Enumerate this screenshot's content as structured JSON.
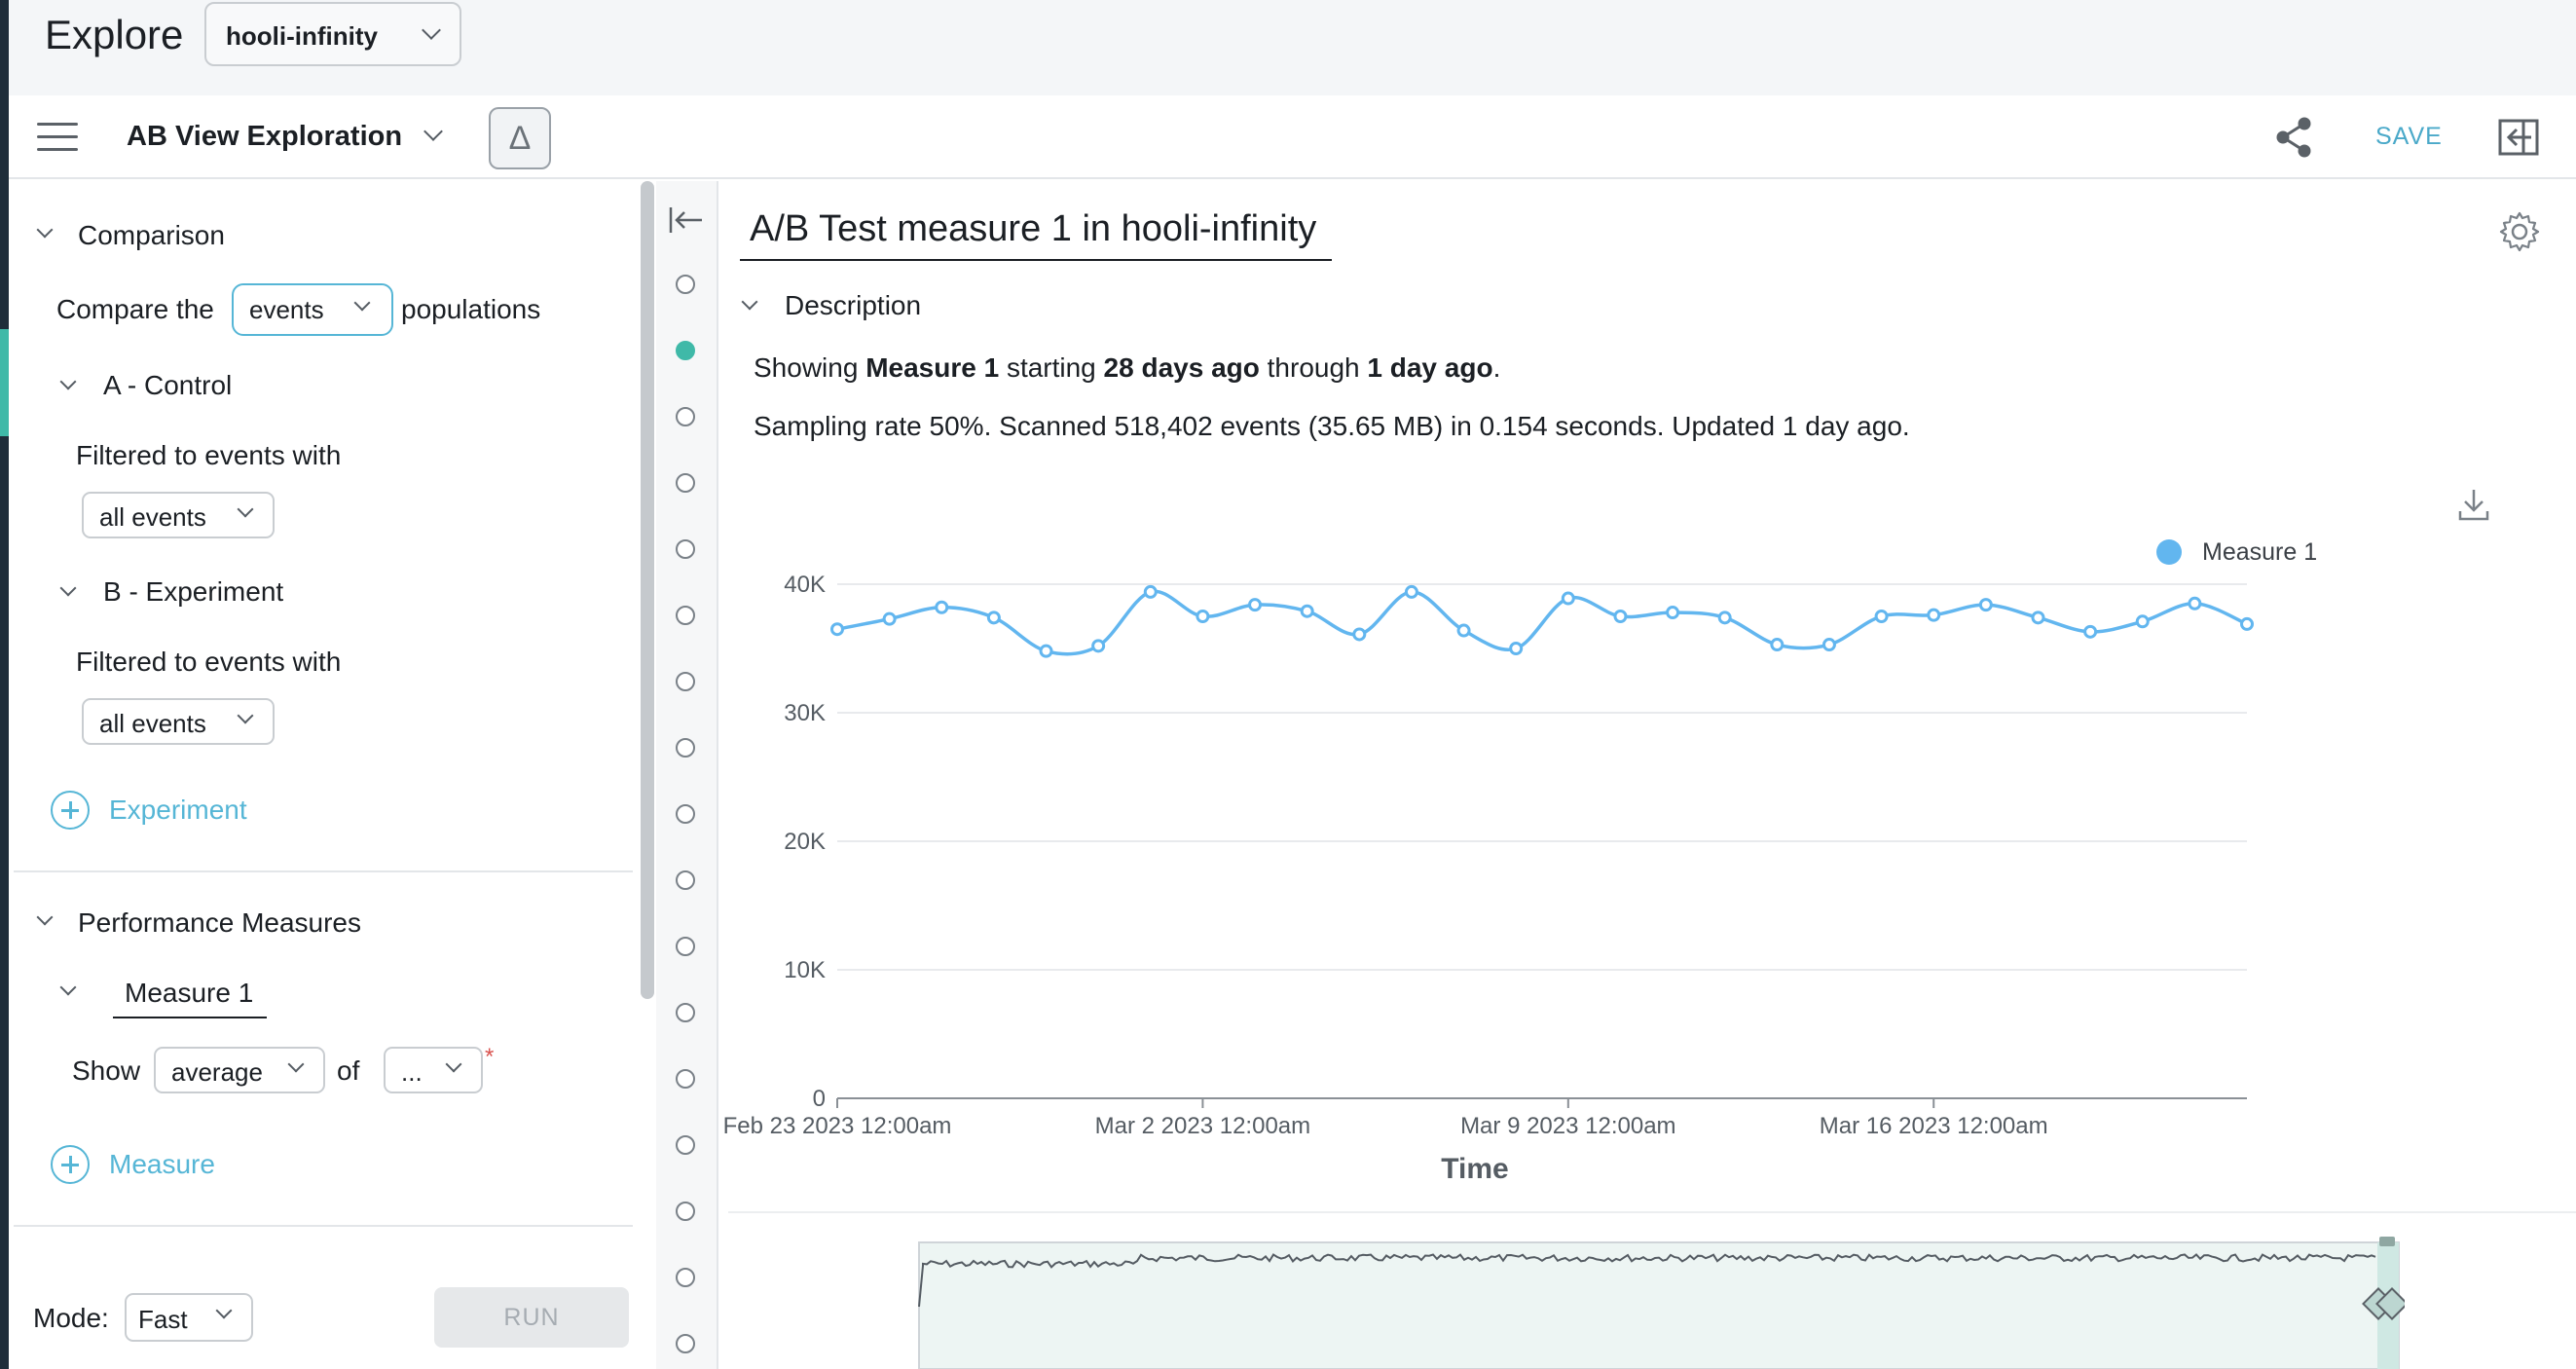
{
  "app": {
    "title": "Explore",
    "dataset": "hooli-infinity"
  },
  "toolbar": {
    "view_name": "AB View Exploration",
    "delta_symbol": "Δ",
    "save_label": "SAVE"
  },
  "comparison": {
    "heading": "Comparison",
    "compare_prefix": "Compare the",
    "compare_value": "events",
    "compare_suffix": "populations",
    "group_a": {
      "heading": "A - Control",
      "filter_label": "Filtered to events with",
      "filter_value": "all events"
    },
    "group_b": {
      "heading": "B - Experiment",
      "filter_label": "Filtered to events with",
      "filter_value": "all events"
    },
    "add_experiment": "Experiment"
  },
  "measures": {
    "heading": "Performance Measures",
    "measure_name": "Measure 1",
    "show_label": "Show",
    "agg_value": "average",
    "of_label": "of",
    "field_value": "...",
    "required_mark": "*",
    "add_measure": "Measure"
  },
  "footer": {
    "mode_label": "Mode:",
    "mode_value": "Fast",
    "run_label": "RUN"
  },
  "main": {
    "title": "A/B Test measure 1 in hooli-infinity",
    "description_heading": "Description",
    "desc": {
      "showing": "Showing",
      "measure": "Measure 1",
      "starting": "starting",
      "from": "28 days ago",
      "through": "through",
      "to": "1 day ago",
      "period": "."
    },
    "stats_line": "Sampling rate 50%. Scanned 518,402 events (35.65 MB) in 0.154 seconds. Updated 1 day ago."
  },
  "steps": {
    "count": 17,
    "active_index": 1
  },
  "colors": {
    "accent": "#56b6d6",
    "series": "#62b6ef",
    "teal": "#3fb9a8"
  },
  "chart_data": {
    "type": "line",
    "xlabel": "Time",
    "ylabel": "",
    "ylim": [
      0,
      40000
    ],
    "y_ticks": [
      "0",
      "10K",
      "20K",
      "30K",
      "40K"
    ],
    "x_ticks": [
      "Feb 23 2023 12:00am",
      "Mar 2 2023 12:00am",
      "Mar 9 2023 12:00am",
      "Mar 16 2023 12:00am"
    ],
    "legend_position": "top-right",
    "x": [
      "Feb 23",
      "Feb 24",
      "Feb 25",
      "Feb 26",
      "Feb 27",
      "Feb 28",
      "Mar 1",
      "Mar 2",
      "Mar 3",
      "Mar 4",
      "Mar 5",
      "Mar 6",
      "Mar 7",
      "Mar 8",
      "Mar 9",
      "Mar 10",
      "Mar 11",
      "Mar 12",
      "Mar 13",
      "Mar 14",
      "Mar 15",
      "Mar 16",
      "Mar 17",
      "Mar 18",
      "Mar 19",
      "Mar 20",
      "Mar 21",
      "Mar 22"
    ],
    "series": [
      {
        "name": "Measure 1",
        "values": [
          36500,
          37300,
          38200,
          37400,
          34800,
          35200,
          39400,
          37500,
          38400,
          37900,
          36100,
          39400,
          36400,
          35000,
          38900,
          37500,
          37800,
          37400,
          35300,
          35300,
          37500,
          37600,
          38400,
          37400,
          36300,
          37100,
          38500,
          36900
        ]
      }
    ],
    "overview_note": "range selector"
  }
}
